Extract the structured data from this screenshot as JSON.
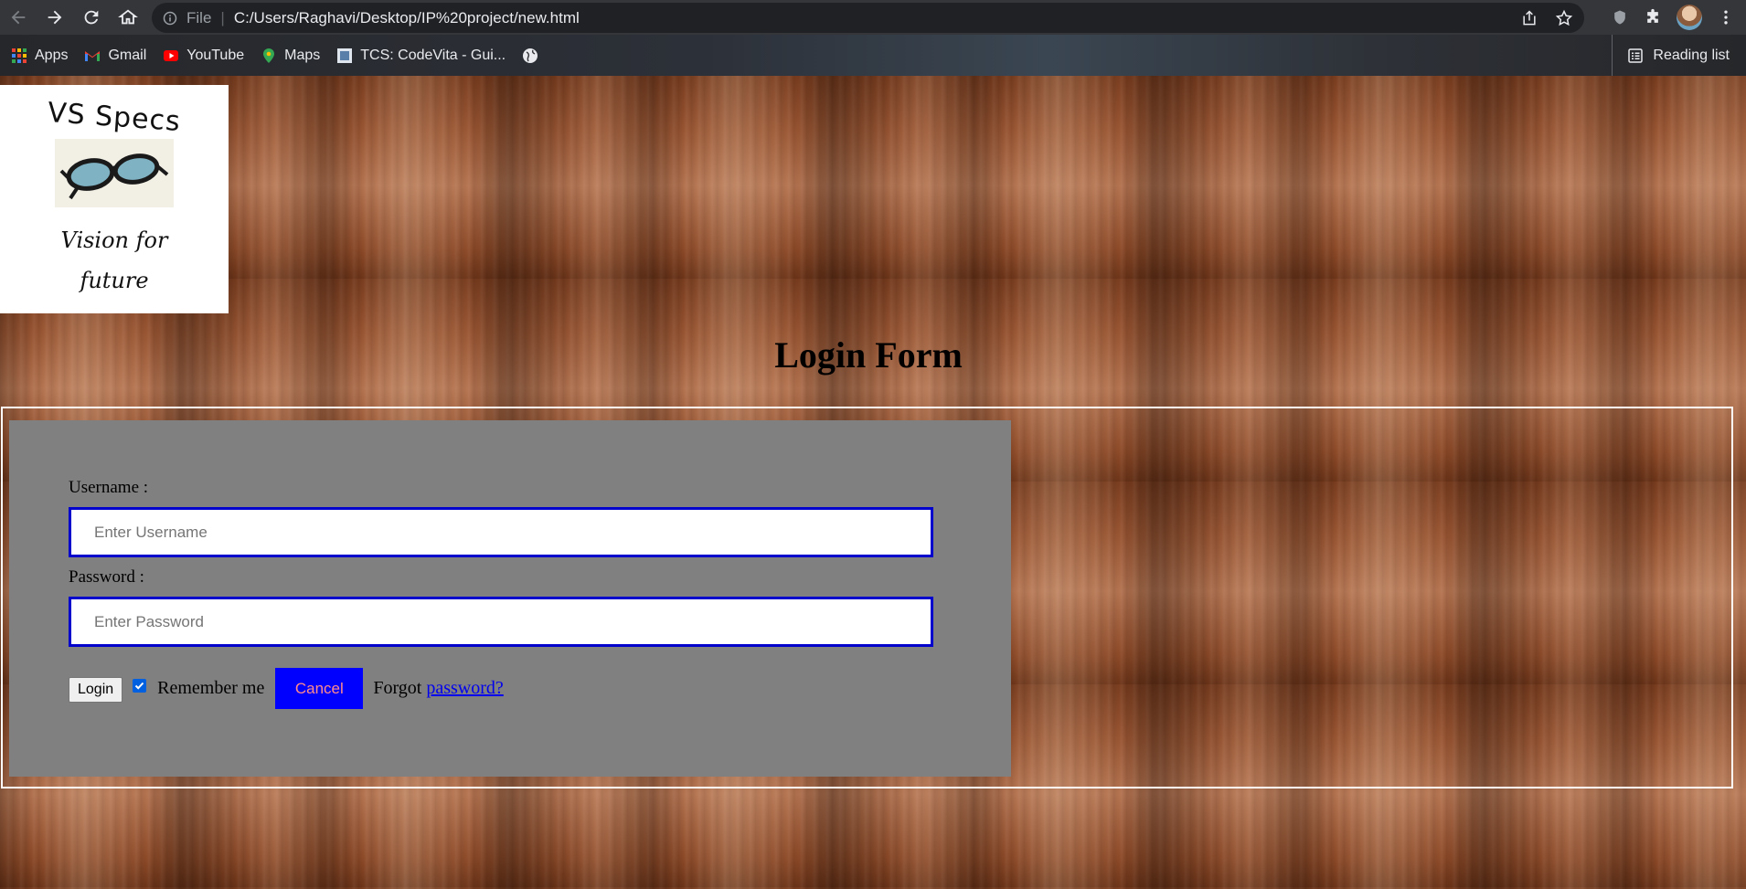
{
  "browser": {
    "url_scheme": "File",
    "url": "C:/Users/Raghavi/Desktop/IP%20project/new.html",
    "bookmarks": [
      {
        "label": "Apps",
        "icon": "apps-grid-icon"
      },
      {
        "label": "Gmail",
        "icon": "gmail-icon"
      },
      {
        "label": "YouTube",
        "icon": "youtube-icon"
      },
      {
        "label": "Maps",
        "icon": "maps-icon"
      },
      {
        "label": "TCS: CodeVita - Gui...",
        "icon": "codevita-icon"
      },
      {
        "label": "",
        "icon": "globe-icon"
      }
    ],
    "reading_list": "Reading list"
  },
  "logo": {
    "title": "VS Specs",
    "tagline": "Vision for future"
  },
  "form": {
    "title": "Login Form",
    "username_label": "Username :",
    "username_placeholder": "Enter Username",
    "password_label": "Password :",
    "password_placeholder": "Enter Password",
    "login_label": "Login",
    "remember_label": "Remember me",
    "remember_checked": true,
    "cancel_label": "Cancel",
    "forgot_text": "Forgot",
    "forgot_link": "password?"
  },
  "colors": {
    "input_border": "#0000cd",
    "cancel_bg": "#0000ff",
    "cancel_text": "#ff8b8b",
    "panel_bg": "#808080",
    "link": "#0000ee"
  }
}
